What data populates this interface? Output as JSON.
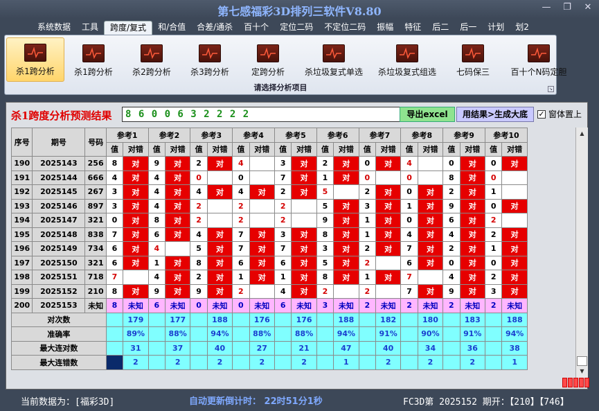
{
  "window": {
    "title": "第七感福彩3D排列三软件V8.80",
    "controls": [
      "—",
      "❐",
      "✕"
    ]
  },
  "menu": [
    "系统数据",
    "工具",
    "跨度/复式",
    "和/合值",
    "合差/通杀",
    "百十个",
    "定位二码",
    "不定位二码",
    "振幅",
    "特征",
    "后二",
    "后一",
    "计划",
    "划2"
  ],
  "menu_active": 2,
  "ribbon": {
    "items": [
      "杀1跨分析",
      "杀1跨分析",
      "杀2跨分析",
      "杀3跨分析",
      "定跨分析",
      "杀垃圾复式单选",
      "杀垃圾复式组选",
      "七码保三",
      "百十个N码定胆"
    ],
    "active": 0,
    "group_label": "请选择分析项目"
  },
  "panel": {
    "title": "杀1跨度分析预测结果",
    "result": "8 6 0 0 6 3 2 2 2 2",
    "btn_excel": "导出excel",
    "btn_generate": "用结果>生成大底",
    "ontop_label": "窗体置上",
    "ontop_checked": "✓"
  },
  "table": {
    "col_seq": "序号",
    "col_period": "期号",
    "col_code": "号码",
    "refs": [
      "参考1",
      "参考2",
      "参考3",
      "参考4",
      "参考5",
      "参考6",
      "参考7",
      "参考8",
      "参考9",
      "参考10"
    ],
    "sub_val": "值",
    "sub_ok": "对错",
    "ok_text": "对",
    "rows": [
      {
        "seq": "190",
        "period": "2025143",
        "code": "256",
        "cells": [
          [
            "8",
            "对",
            "n"
          ],
          [
            "9",
            "对",
            "n"
          ],
          [
            "2",
            "对",
            "n"
          ],
          [
            "4",
            "",
            "r"
          ],
          [
            "3",
            "对",
            "n"
          ],
          [
            "2",
            "对",
            "n"
          ],
          [
            "0",
            "对",
            "n"
          ],
          [
            "4",
            "",
            "r"
          ],
          [
            "0",
            "对",
            "n"
          ],
          [
            "0",
            "对",
            "n"
          ]
        ]
      },
      {
        "seq": "191",
        "period": "2025144",
        "code": "666",
        "cells": [
          [
            "4",
            "对",
            "n"
          ],
          [
            "4",
            "对",
            "n"
          ],
          [
            "0",
            "",
            "r"
          ],
          [
            "0",
            "",
            "n"
          ],
          [
            "7",
            "对",
            "n"
          ],
          [
            "1",
            "对",
            "n"
          ],
          [
            "0",
            "",
            "r"
          ],
          [
            "0",
            "",
            "r"
          ],
          [
            "8",
            "对",
            "n"
          ],
          [
            "0",
            "",
            "r"
          ]
        ]
      },
      {
        "seq": "192",
        "period": "2025145",
        "code": "267",
        "cells": [
          [
            "3",
            "对",
            "n"
          ],
          [
            "4",
            "对",
            "n"
          ],
          [
            "4",
            "对",
            "n"
          ],
          [
            "4",
            "对",
            "n"
          ],
          [
            "2",
            "对",
            "n"
          ],
          [
            "5",
            "",
            "r"
          ],
          [
            "2",
            "对",
            "n"
          ],
          [
            "0",
            "对",
            "n"
          ],
          [
            "2",
            "对",
            "n"
          ],
          [
            "1",
            "",
            "n"
          ]
        ]
      },
      {
        "seq": "193",
        "period": "2025146",
        "code": "897",
        "cells": [
          [
            "3",
            "对",
            "n"
          ],
          [
            "4",
            "对",
            "n"
          ],
          [
            "2",
            "",
            "r"
          ],
          [
            "2",
            "",
            "r"
          ],
          [
            "2",
            "",
            "r"
          ],
          [
            "5",
            "对",
            "n"
          ],
          [
            "3",
            "对",
            "n"
          ],
          [
            "1",
            "对",
            "n"
          ],
          [
            "9",
            "对",
            "n"
          ],
          [
            "0",
            "对",
            "n"
          ]
        ]
      },
      {
        "seq": "194",
        "period": "2025147",
        "code": "321",
        "cells": [
          [
            "0",
            "对",
            "n"
          ],
          [
            "8",
            "对",
            "n"
          ],
          [
            "2",
            "",
            "r"
          ],
          [
            "2",
            "",
            "r"
          ],
          [
            "2",
            "",
            "r"
          ],
          [
            "9",
            "对",
            "n"
          ],
          [
            "1",
            "对",
            "n"
          ],
          [
            "0",
            "对",
            "n"
          ],
          [
            "6",
            "对",
            "n"
          ],
          [
            "2",
            "",
            "r"
          ]
        ]
      },
      {
        "seq": "195",
        "period": "2025148",
        "code": "838",
        "cells": [
          [
            "7",
            "对",
            "n"
          ],
          [
            "6",
            "对",
            "n"
          ],
          [
            "4",
            "对",
            "n"
          ],
          [
            "7",
            "对",
            "n"
          ],
          [
            "3",
            "对",
            "n"
          ],
          [
            "8",
            "对",
            "n"
          ],
          [
            "1",
            "对",
            "n"
          ],
          [
            "4",
            "对",
            "n"
          ],
          [
            "4",
            "对",
            "n"
          ],
          [
            "2",
            "对",
            "n"
          ]
        ]
      },
      {
        "seq": "196",
        "period": "2025149",
        "code": "734",
        "cells": [
          [
            "6",
            "对",
            "n"
          ],
          [
            "4",
            "",
            "r"
          ],
          [
            "5",
            "对",
            "n"
          ],
          [
            "7",
            "对",
            "n"
          ],
          [
            "7",
            "对",
            "n"
          ],
          [
            "3",
            "对",
            "n"
          ],
          [
            "2",
            "对",
            "n"
          ],
          [
            "7",
            "对",
            "n"
          ],
          [
            "2",
            "对",
            "n"
          ],
          [
            "1",
            "对",
            "n"
          ]
        ]
      },
      {
        "seq": "197",
        "period": "2025150",
        "code": "321",
        "cells": [
          [
            "6",
            "对",
            "n"
          ],
          [
            "1",
            "对",
            "n"
          ],
          [
            "8",
            "对",
            "n"
          ],
          [
            "6",
            "对",
            "n"
          ],
          [
            "6",
            "对",
            "n"
          ],
          [
            "5",
            "对",
            "n"
          ],
          [
            "2",
            "",
            "r"
          ],
          [
            "6",
            "对",
            "n"
          ],
          [
            "0",
            "对",
            "n"
          ],
          [
            "0",
            "对",
            "n"
          ]
        ]
      },
      {
        "seq": "198",
        "period": "2025151",
        "code": "718",
        "cells": [
          [
            "7",
            "",
            "r"
          ],
          [
            "4",
            "对",
            "n"
          ],
          [
            "2",
            "对",
            "n"
          ],
          [
            "1",
            "对",
            "n"
          ],
          [
            "1",
            "对",
            "n"
          ],
          [
            "8",
            "对",
            "n"
          ],
          [
            "1",
            "对",
            "n"
          ],
          [
            "7",
            "",
            "r"
          ],
          [
            "4",
            "对",
            "n"
          ],
          [
            "2",
            "对",
            "n"
          ]
        ]
      },
      {
        "seq": "199",
        "period": "2025152",
        "code": "210",
        "cells": [
          [
            "8",
            "对",
            "n"
          ],
          [
            "9",
            "对",
            "n"
          ],
          [
            "9",
            "对",
            "n"
          ],
          [
            "2",
            "",
            "r"
          ],
          [
            "4",
            "对",
            "n"
          ],
          [
            "2",
            "",
            "r"
          ],
          [
            "2",
            "",
            "r"
          ],
          [
            "7",
            "对",
            "n"
          ],
          [
            "9",
            "对",
            "n"
          ],
          [
            "3",
            "对",
            "n"
          ]
        ]
      }
    ],
    "pred": {
      "seq": "200",
      "period": "2025153",
      "code": "未知",
      "vals": [
        "8",
        "6",
        "0",
        "0",
        "6",
        "3",
        "2",
        "2",
        "2",
        "2"
      ],
      "unk": "未知"
    },
    "stats": [
      {
        "label": "对次数",
        "values": [
          "179",
          "177",
          "188",
          "176",
          "176",
          "188",
          "182",
          "180",
          "183",
          "188"
        ]
      },
      {
        "label": "准确率",
        "values": [
          "89%",
          "88%",
          "94%",
          "88%",
          "88%",
          "94%",
          "91%",
          "90%",
          "91%",
          "94%"
        ]
      },
      {
        "label": "最大连对数",
        "values": [
          "31",
          "37",
          "40",
          "27",
          "21",
          "47",
          "40",
          "34",
          "36",
          "38"
        ]
      },
      {
        "label": "最大连错数",
        "values": [
          "2",
          "2",
          "2",
          "2",
          "2",
          "1",
          "2",
          "2",
          "2",
          "1"
        ]
      }
    ]
  },
  "statusbar": {
    "left": "当前数据为：[福彩3D]",
    "mid": "自动更新倒计时：  22时51分1秒",
    "right": "FC3D第 2025152 期开：【210】【746】"
  }
}
